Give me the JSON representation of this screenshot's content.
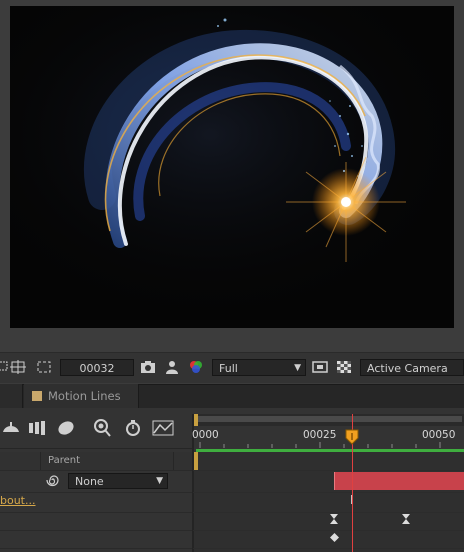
{
  "viewer": {
    "timecode": "00032",
    "resolution": "Full",
    "camera": "Active Camera"
  },
  "timeline": {
    "tab_label": "Motion Lines",
    "column_parent": "Parent",
    "parent_value": "None",
    "layer_link": "bout...",
    "ruler_labels": [
      "0000",
      "00025",
      "00050"
    ]
  },
  "colors": {
    "accent_orange": "#f0a020",
    "playhead": "#e04040",
    "work_area_green": "#3fae3f",
    "layer_bar": "#c8424b",
    "link": "#d6a84a"
  },
  "icons": [
    "snapshot-icon",
    "person-icon",
    "rgb-channels-icon",
    "fast-preview-icon",
    "transparency-grid-icon",
    "motion-blur-icon",
    "graph-editor-icon",
    "spiral-icon"
  ]
}
